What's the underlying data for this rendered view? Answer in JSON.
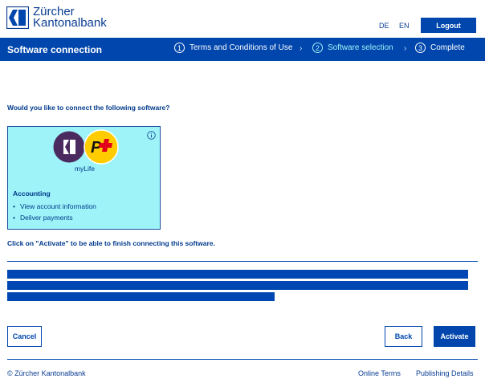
{
  "header": {
    "brand_line1": "Zürcher",
    "brand_line2": "Kantonalbank",
    "languages": [
      "DE",
      "EN"
    ],
    "logout_label": "Logout"
  },
  "titlebar": {
    "title": "Software connection",
    "steps": [
      {
        "number": "1",
        "label": "Terms and Conditions of Use",
        "state": "done"
      },
      {
        "number": "2",
        "label": "Software selection",
        "state": "active"
      },
      {
        "number": "3",
        "label": "Complete",
        "state": "upcoming"
      }
    ],
    "separator": "›"
  },
  "main": {
    "question": "Would you like to connect the following software?",
    "card": {
      "app_name": "myLife",
      "logo_badge_letter": "P",
      "permission_group": "Accounting",
      "permissions": [
        "View account information",
        "Deliver payments"
      ],
      "icons": {
        "info": "info-icon",
        "zkb": "zkb-app-logo",
        "postfinance": "postfinance-logo"
      }
    },
    "hint": "Click on \"Activate\" to be able to finish connecting this software."
  },
  "actions": {
    "cancel": "Cancel",
    "back": "Back",
    "activate": "Activate"
  },
  "footer": {
    "copyright": "© Zürcher Kantonalbank",
    "links": [
      "Online Terms",
      "Publishing Details"
    ]
  },
  "colors": {
    "primary": "#0046ad",
    "accent_cyan": "#9df3f8",
    "zkb_purple": "#4b2a5f",
    "postfinance_yellow": "#ffcc00",
    "postfinance_red": "#e2001a"
  }
}
